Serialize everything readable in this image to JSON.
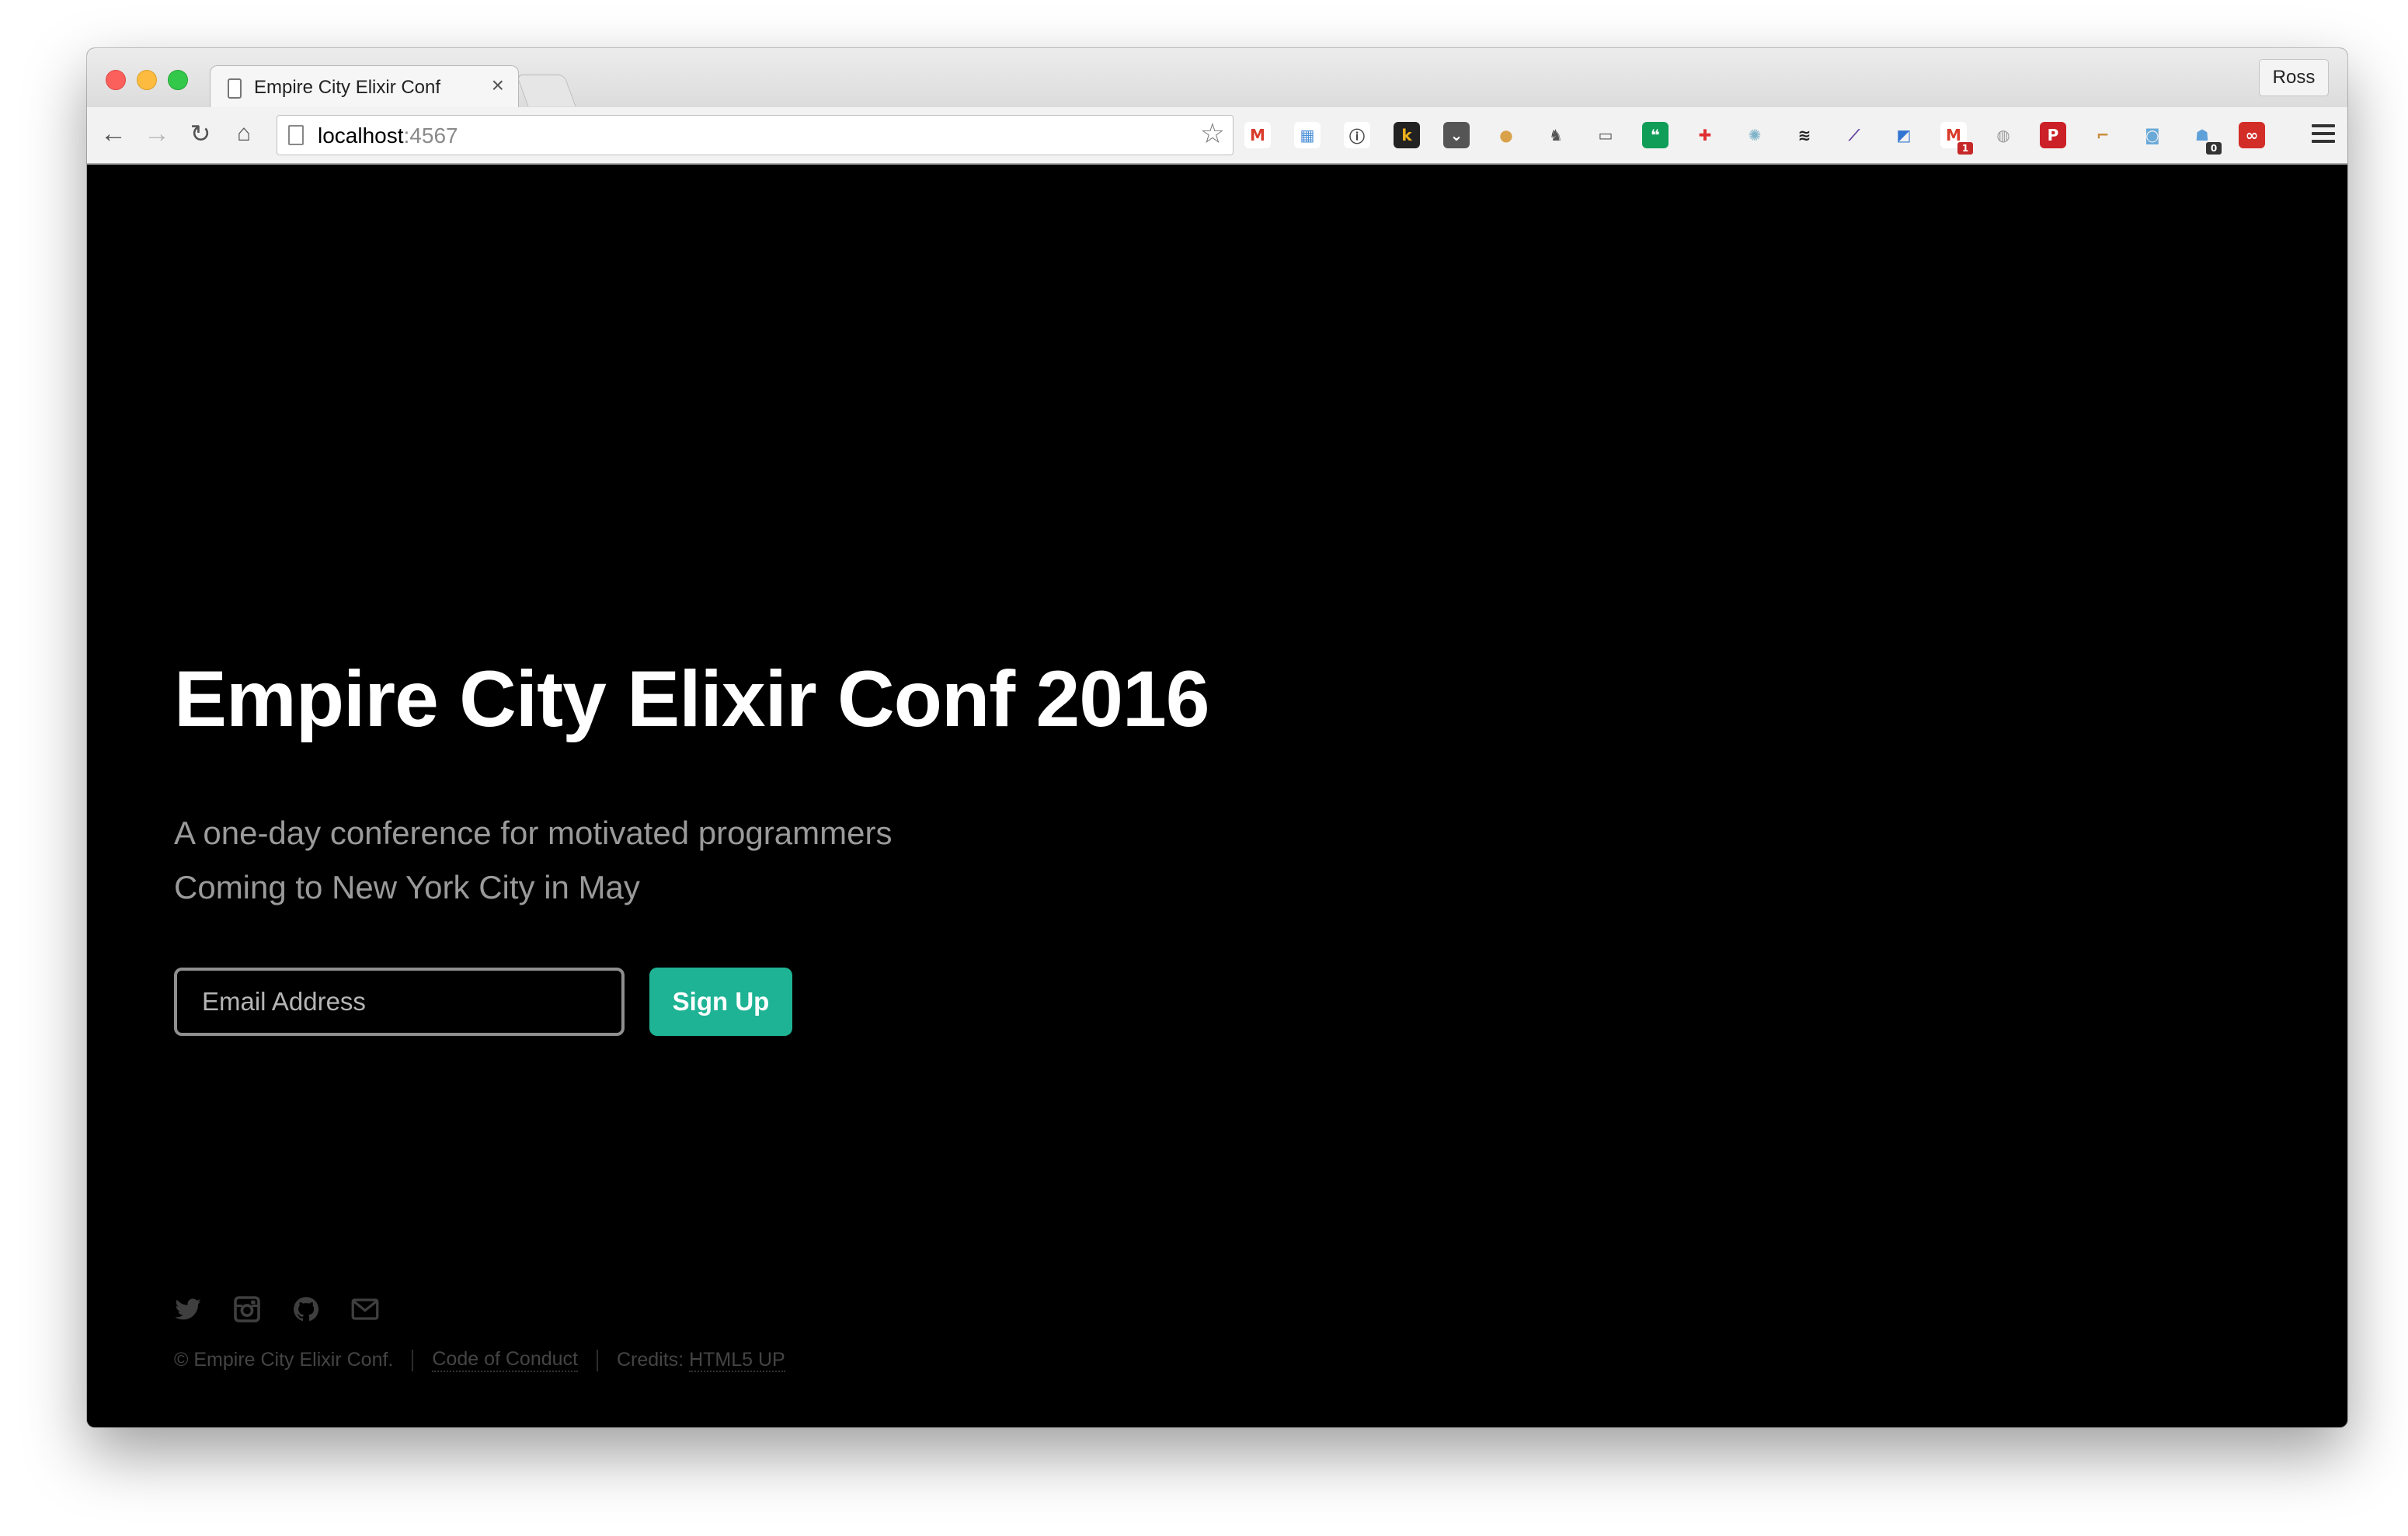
{
  "browser": {
    "tab_title": "Empire City Elixir Conf",
    "tab_close": "×",
    "profile_name": "Ross",
    "url_host": "localhost",
    "url_port": ":4567",
    "extensions": [
      {
        "name": "gmail-icon",
        "glyph": "M",
        "color": "#d93b2b",
        "bg": "#ffffff"
      },
      {
        "name": "calendar-icon",
        "glyph": "▦",
        "color": "#4a8fd6",
        "bg": "#ffffff"
      },
      {
        "name": "onepassword-icon",
        "glyph": "ⓘ",
        "color": "#444444",
        "bg": "#ffffff"
      },
      {
        "name": "k-icon",
        "glyph": "k",
        "color": "#f1b11c",
        "bg": "#222222"
      },
      {
        "name": "pocket-icon",
        "glyph": "⌄",
        "color": "#ffffff",
        "bg": "#555555"
      },
      {
        "name": "cookie-icon",
        "glyph": "●",
        "color": "#d9a14a",
        "bg": "#f2f2f2"
      },
      {
        "name": "evernote-icon",
        "glyph": "♞",
        "color": "#555555",
        "bg": "#f2f2f2"
      },
      {
        "name": "cast-icon",
        "glyph": "▭",
        "color": "#555555",
        "bg": "#f2f2f2"
      },
      {
        "name": "hangouts-icon",
        "glyph": "❝",
        "color": "#ffffff",
        "bg": "#0f9d58"
      },
      {
        "name": "plus-icon",
        "glyph": "✚",
        "color": "#e02f2f",
        "bg": "#f2f2f2"
      },
      {
        "name": "octopus-icon",
        "glyph": "✺",
        "color": "#7fb3c8",
        "bg": "#f2f2f2"
      },
      {
        "name": "buffer-icon",
        "glyph": "≋",
        "color": "#222222",
        "bg": "#f2f2f2"
      },
      {
        "name": "eyedropper-icon",
        "glyph": "⟋",
        "color": "#6a4aa0",
        "bg": "#f2f2f2"
      },
      {
        "name": "delicious-icon",
        "glyph": "◩",
        "color": "#3274d1",
        "bg": "#f2f2f2"
      },
      {
        "name": "gmail-checker-icon",
        "glyph": "M",
        "color": "#d93b2b",
        "bg": "#ffffff",
        "badge": "1",
        "badge_color": "#c62828"
      },
      {
        "name": "globe-icon",
        "glyph": "◍",
        "color": "#9a9a9a",
        "bg": "#f2f2f2"
      },
      {
        "name": "pinterest-icon",
        "glyph": "P",
        "color": "#ffffff",
        "bg": "#cb2027"
      },
      {
        "name": "ruler-icon",
        "glyph": "⌐",
        "color": "#c98a3a",
        "bg": "#f2f2f2"
      },
      {
        "name": "camera-icon",
        "glyph": "◙",
        "color": "#6aa9d8",
        "bg": "#f2f2f2"
      },
      {
        "name": "ghostery-icon",
        "glyph": "☗",
        "color": "#5ea0d8",
        "bg": "#f2f2f2",
        "badge": "0",
        "badge_color": "#333333"
      },
      {
        "name": "lastpass-icon",
        "glyph": "∞",
        "color": "#ffffff",
        "bg": "#d32d27"
      }
    ]
  },
  "page": {
    "title": "Empire City Elixir Conf 2016",
    "subtitle_line1": "A one-day conference for motivated programmers",
    "subtitle_line2": "Coming to New York City in May",
    "email_placeholder": "Email Address",
    "signup_label": "Sign Up",
    "footer": {
      "copyright": "© Empire City Elixir Conf.",
      "code_of_conduct": "Code of Conduct",
      "credits_prefix": "Credits: ",
      "credits_link": "HTML5 UP"
    }
  },
  "colors": {
    "accent": "#1eb394",
    "page_bg": "#000000",
    "title": "#ffffff",
    "subtitle": "#9a9a9a",
    "footer": "#444444"
  }
}
